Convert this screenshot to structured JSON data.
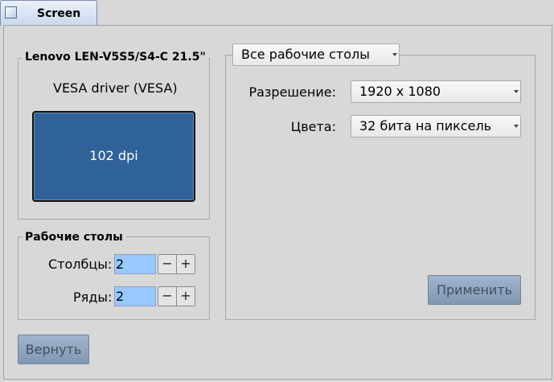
{
  "tab": {
    "label": "Screen"
  },
  "monitor_group": {
    "title": "Lenovo LEN-V5S5/S4-C 21.5\"",
    "driver": "VESA driver (VESA)",
    "dpi_label": "102 dpi"
  },
  "desktops_group": {
    "title": "Рабочие столы",
    "columns_label": "Столбцы:",
    "columns_value": "2",
    "rows_label": "Ряды:",
    "rows_value": "2",
    "minus": "−",
    "plus": "+"
  },
  "settings": {
    "workspace_selector": "Все рабочие столы",
    "resolution_label": "Разрешение:",
    "resolution_value": "1920 x 1080",
    "colors_label": "Цвета:",
    "colors_value": "32 бита на пиксель",
    "apply_label": "Применить"
  },
  "revert_label": "Вернуть"
}
